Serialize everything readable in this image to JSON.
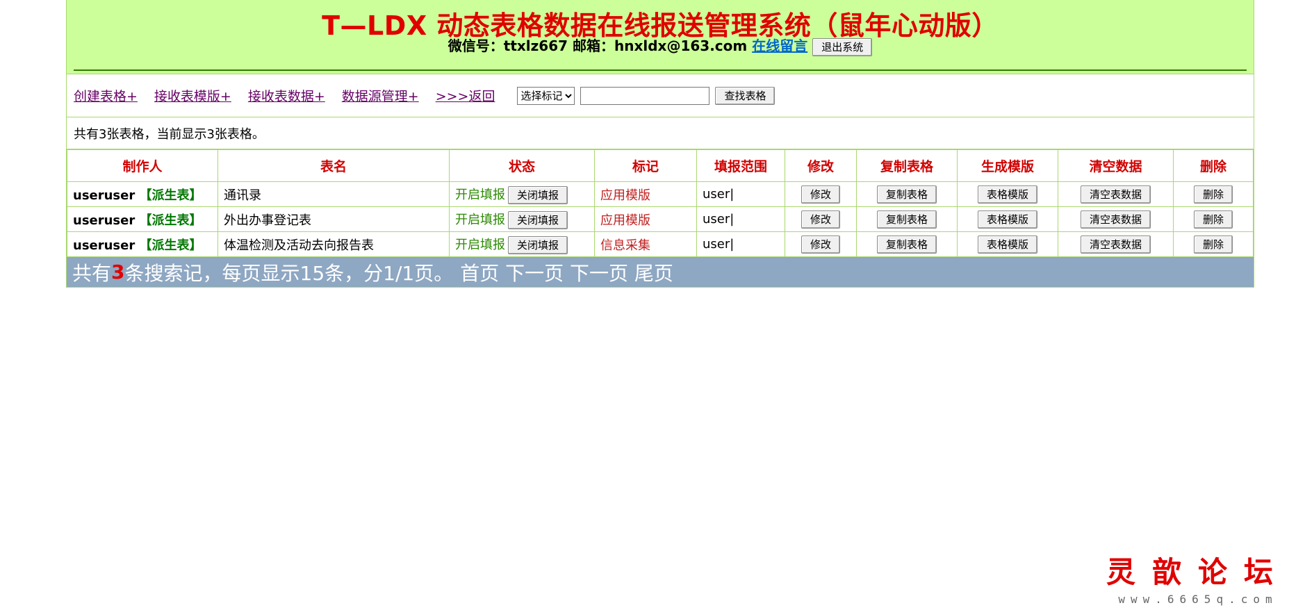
{
  "header": {
    "title": "T—LDX 动态表格数据在线报送管理系统（鼠年心动版）",
    "contact_label": "微信号：ttxlz667 邮箱：hnxldx@163.com",
    "message_link": "在线留言",
    "logout_button": "退出系统"
  },
  "nav": {
    "links": [
      "创建表格+",
      "接收表模版+",
      "接收表数据+",
      "数据源管理+",
      ">>>返回"
    ],
    "select_value": "选择标记",
    "search_value": "",
    "search_button": "查找表格"
  },
  "summary": "共有3张表格，当前显示3张表格。",
  "table": {
    "headers": [
      "制作人",
      "表名",
      "状态",
      "标记",
      "填报范围",
      "修改",
      "复制表格",
      "生成模版",
      "清空数据",
      "删除"
    ],
    "rows": [
      {
        "creator": "useruser",
        "derived": "【派生表】",
        "name": "通讯录",
        "status": "开启填报",
        "status_button": "关闭填报",
        "mark": "应用模版",
        "scope": "user|",
        "edit": "修改",
        "copy": "复制表格",
        "template": "表格模版",
        "clear": "清空表数据",
        "delete": "删除"
      },
      {
        "creator": "useruser",
        "derived": "【派生表】",
        "name": "外出办事登记表",
        "status": "开启填报",
        "status_button": "关闭填报",
        "mark": "应用模版",
        "scope": "user|",
        "edit": "修改",
        "copy": "复制表格",
        "template": "表格模版",
        "clear": "清空表数据",
        "delete": "删除"
      },
      {
        "creator": "useruser",
        "derived": "【派生表】",
        "name": "体温检测及活动去向报告表",
        "status": "开启填报",
        "status_button": "关闭填报",
        "mark": "信息采集",
        "scope": "user|",
        "edit": "修改",
        "copy": "复制表格",
        "template": "表格模版",
        "clear": "清空表数据",
        "delete": "删除"
      }
    ]
  },
  "footer": {
    "prefix": "共有",
    "count": "3",
    "suffix": "条搜索记，每页显示15条，分1/1页。",
    "pager": "首页 下一页 下一页 尾页"
  },
  "watermark": {
    "title": "灵歆论坛",
    "url": "www.6665q.com"
  },
  "colors": {
    "header_bg": "#ccff99",
    "title_red": "#e00000",
    "footer_bg": "#8ea7c2",
    "border_green": "#a9d86e"
  }
}
